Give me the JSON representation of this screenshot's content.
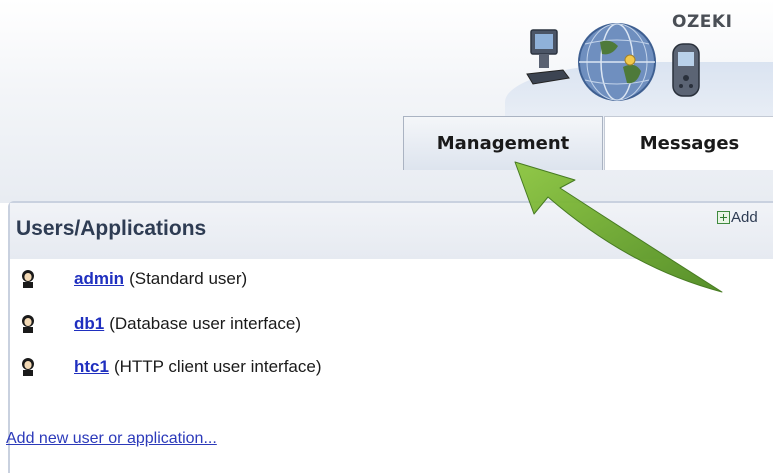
{
  "header": {
    "logo_text": "OZEKI",
    "tabs": [
      {
        "label": "Management",
        "active": true
      },
      {
        "label": "Messages",
        "active": false
      }
    ]
  },
  "panel": {
    "title": "Users/Applications",
    "add_label": "Add",
    "users": [
      {
        "name": "admin",
        "description": "(Standard user)"
      },
      {
        "name": "db1",
        "description": "(Database user interface)"
      },
      {
        "name": "htc1",
        "description": "(HTTP client user interface)"
      }
    ],
    "add_new_label": "Add new user or application..."
  },
  "icons": [
    "logo-computer-icon",
    "logo-globe-icon",
    "logo-phone-icon",
    "add-icon",
    "user-icon",
    "green-arrow"
  ],
  "colors": {
    "link": "#1f2fbf",
    "panel_title": "#2e3c53",
    "arrow": "#6aa325",
    "tab_active_bg": "#dde4ee"
  }
}
